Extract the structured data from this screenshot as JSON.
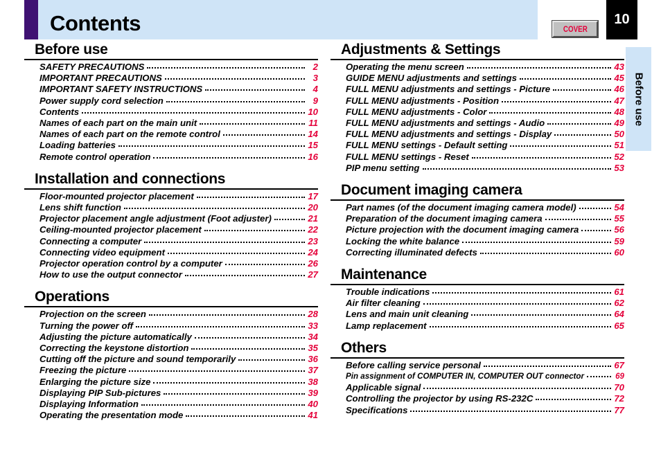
{
  "header": {
    "title": "Contents",
    "cover_button_label": "COVER",
    "page_number": "10",
    "accent_color": "#3f1273",
    "band_color": "#cfe4f7"
  },
  "side_tab": {
    "label": "Before use"
  },
  "colors": {
    "page_number_red": "#e4003a",
    "heading_black": "#000000"
  },
  "columns": {
    "left": [
      {
        "heading": "Before use",
        "entries": [
          {
            "title": "SAFETY PRECAUTIONS",
            "page": "2"
          },
          {
            "title": "IMPORTANT PRECAUTIONS",
            "page": "3"
          },
          {
            "title": "IMPORTANT SAFETY INSTRUCTIONS",
            "page": "4"
          },
          {
            "title": "Power supply cord selection",
            "page": "9"
          },
          {
            "title": "Contents",
            "page": "10"
          },
          {
            "title": "Names of each part on the main unit",
            "page": "11"
          },
          {
            "title": "Names of each part on the remote control",
            "page": "14"
          },
          {
            "title": "Loading batteries",
            "page": "15"
          },
          {
            "title": "Remote control operation",
            "page": "16"
          }
        ]
      },
      {
        "heading": "Installation and connections",
        "entries": [
          {
            "title": "Floor-mounted projector placement",
            "page": "17"
          },
          {
            "title": "Lens shift function",
            "page": "20"
          },
          {
            "title": "Projector placement angle adjustment (Foot adjuster)",
            "page": "21"
          },
          {
            "title": "Ceiling-mounted projector placement",
            "page": "22"
          },
          {
            "title": "Connecting a computer",
            "page": "23"
          },
          {
            "title": "Connecting video equipment",
            "page": "24"
          },
          {
            "title": "Projector operation control by a computer",
            "page": "26"
          },
          {
            "title": "How to use the output connector",
            "page": "27"
          }
        ]
      },
      {
        "heading": "Operations",
        "entries": [
          {
            "title": "Projection on the screen",
            "page": "28"
          },
          {
            "title": "Turning the power off",
            "page": "33"
          },
          {
            "title": "Adjusting the picture automatically",
            "page": "34"
          },
          {
            "title": "Correcting the keystone distortion",
            "page": "35"
          },
          {
            "title": "Cutting off the picture and sound temporarily",
            "page": "36"
          },
          {
            "title": "Freezing the picture",
            "page": "37"
          },
          {
            "title": "Enlarging the picture size",
            "page": "38"
          },
          {
            "title": "Displaying PIP Sub-pictures",
            "page": "39"
          },
          {
            "title": "Displaying Information",
            "page": "40"
          },
          {
            "title": "Operating the presentation mode",
            "page": "41"
          }
        ]
      }
    ],
    "right": [
      {
        "heading": "Adjustments & Settings",
        "entries": [
          {
            "title": "Operating the menu screen",
            "page": "43"
          },
          {
            "title": "GUIDE MENU adjustments and settings",
            "page": "45"
          },
          {
            "title": "FULL MENU adjustments and settings - Picture",
            "page": "46"
          },
          {
            "title": "FULL MENU adjustments - Position",
            "page": "47"
          },
          {
            "title": "FULL MENU adjustments - Color",
            "page": "48"
          },
          {
            "title": "FULL MENU adjustments and settings - Audio",
            "page": "49"
          },
          {
            "title": "FULL MENU adjustments and settings - Display",
            "page": "50"
          },
          {
            "title": "FULL MENU settings - Default setting",
            "page": "51"
          },
          {
            "title": "FULL MENU settings - Reset",
            "page": "52"
          },
          {
            "title": "PIP menu setting",
            "page": "53"
          }
        ]
      },
      {
        "heading": "Document imaging camera",
        "entries": [
          {
            "title": "Part names (of the document imaging camera model)",
            "page": "54"
          },
          {
            "title": "Preparation of the document imaging camera",
            "page": "55"
          },
          {
            "title": "Picture projection with the document imaging camera",
            "page": "56"
          },
          {
            "title": "Locking the white balance",
            "page": "59"
          },
          {
            "title": "Correcting illuminated defects",
            "page": "60"
          }
        ]
      },
      {
        "heading": "Maintenance",
        "entries": [
          {
            "title": "Trouble indications",
            "page": "61"
          },
          {
            "title": "Air filter cleaning",
            "page": "62"
          },
          {
            "title": "Lens and main unit cleaning",
            "page": "64"
          },
          {
            "title": "Lamp replacement",
            "page": "65"
          }
        ]
      },
      {
        "heading": "Others",
        "entries": [
          {
            "title": "Before calling service personal",
            "page": "67"
          },
          {
            "title": "Pin assignment of COMPUTER IN, COMPUTER OUT connector",
            "page": "69",
            "small": true
          },
          {
            "title": "Applicable signal",
            "page": "70"
          },
          {
            "title": "Controlling the projector by using RS-232C",
            "page": "72"
          },
          {
            "title": "Specifications",
            "page": "77"
          }
        ]
      }
    ]
  }
}
